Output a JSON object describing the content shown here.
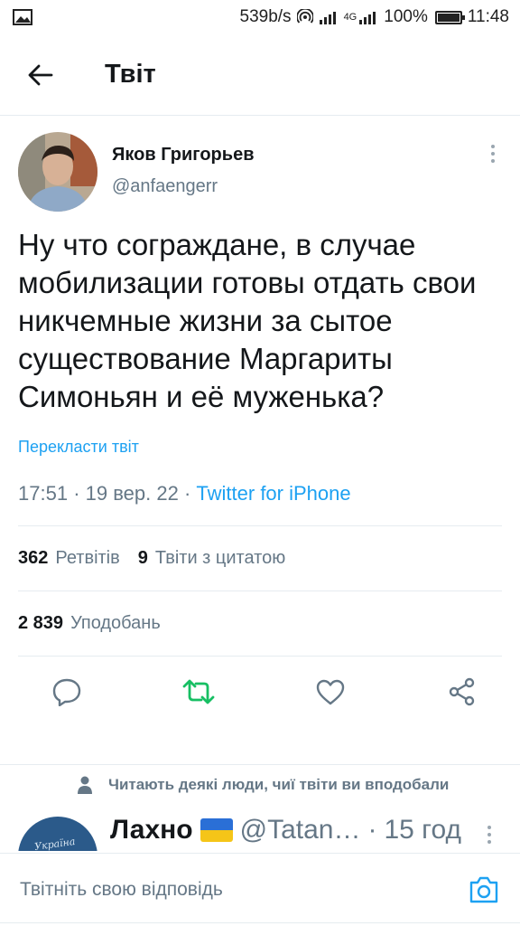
{
  "status_bar": {
    "speed": "539b/s",
    "network": "4G",
    "battery": "100%",
    "time": "11:48"
  },
  "header": {
    "title": "Твіт"
  },
  "tweet": {
    "author_name": "Яков Григорьев",
    "author_handle": "@anfaengerr",
    "text": "Ну что сограждане, в случае мобилизации готовы отдать свои никчемные жизни за сытое существование Маргариты Симоньян и её муженька?",
    "translate_label": "Перекласти твіт",
    "time": "17:51",
    "date": "19 вер. 22",
    "separator": "·",
    "source": "Twitter for iPhone",
    "retweets_count": "362",
    "retweets_label": "Ретвітів",
    "quotes_count": "9",
    "quotes_label": "Твіти з цитатою",
    "likes_count": "2 839",
    "likes_label": "Уподобань"
  },
  "actions": [
    "reply-icon",
    "retweet-icon",
    "like-icon",
    "share-icon"
  ],
  "colors": {
    "accent": "#1da1f2",
    "retweet": "#17bf63",
    "secondary_text": "#657786",
    "divider": "#e6ecf0"
  },
  "social_context": {
    "text": "Читають деякі люди, чиї твіти ви вподобали"
  },
  "reply_preview": {
    "name": "Лахно",
    "handle": "@Tatan…",
    "dot": "·",
    "age": "15 год"
  },
  "compose": {
    "placeholder": "Твітніть свою відповідь"
  }
}
